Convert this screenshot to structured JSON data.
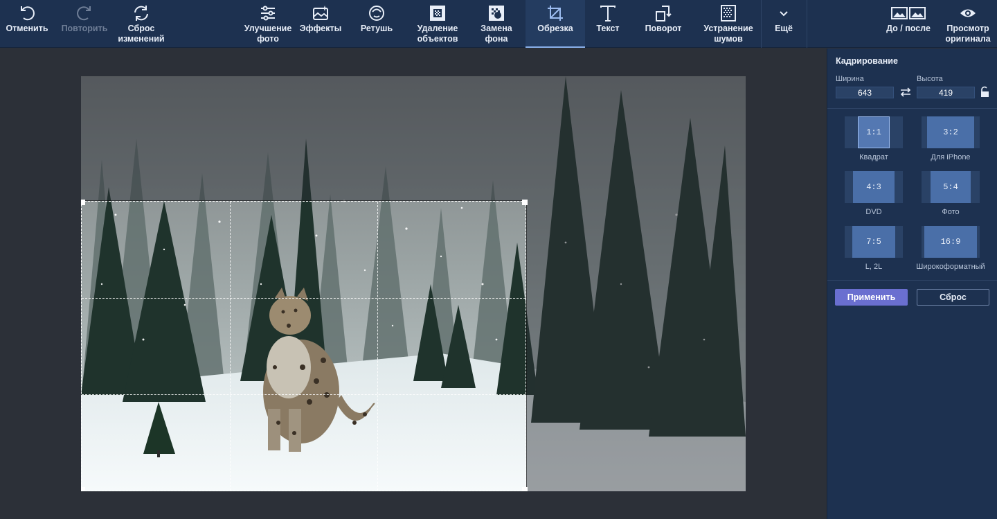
{
  "toolbar": {
    "undo": "Отменить",
    "redo": "Повторить",
    "reset_changes": "Сброс\nизменений",
    "enhance": "Улучшение\nфото",
    "effects": "Эффекты",
    "retouch": "Ретушь",
    "remove_objects": "Удаление\nобъектов",
    "replace_bg": "Замена\nфона",
    "crop": "Обрезка",
    "text": "Текст",
    "rotate": "Поворот",
    "denoise": "Устранение\nшумов",
    "more": "Ещё",
    "before_after": "До / после",
    "view_original": "Просмотр\nоригинала"
  },
  "panel": {
    "title": "Кадрирование",
    "width_label": "Ширина",
    "height_label": "Высота",
    "width_value": "643",
    "height_value": "419",
    "presets": [
      {
        "ratio": "1:1",
        "caption": "Квадрат"
      },
      {
        "ratio": "3:2",
        "caption": "Для iPhone"
      },
      {
        "ratio": "4:3",
        "caption": "DVD"
      },
      {
        "ratio": "5:4",
        "caption": "Фото"
      },
      {
        "ratio": "7:5",
        "caption": "L, 2L"
      },
      {
        "ratio": "16:9",
        "caption": "Широкоформатный"
      }
    ],
    "apply": "Применить",
    "reset": "Сброс"
  },
  "colors": {
    "toolbar_bg": "#1d3150",
    "accent": "#6a6fd0"
  }
}
